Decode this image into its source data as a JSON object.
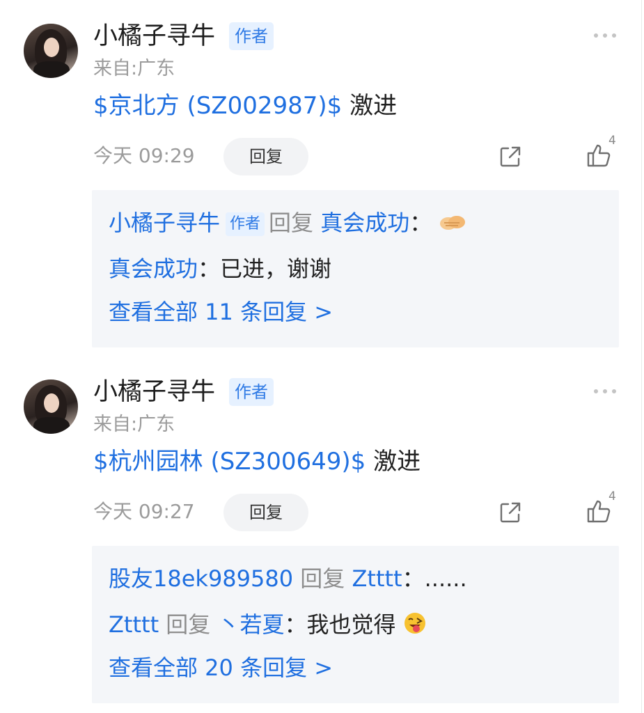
{
  "posts": [
    {
      "author": "小橘子寻牛",
      "author_badge": "作者",
      "location": "来自:广东",
      "stock_tag": "$京北方 (SZ002987)$",
      "text": " 激进",
      "time": "今天 09:29",
      "reply_label": "回复",
      "like_count": "4",
      "replies": [
        {
          "from": "小橘子寻牛",
          "badge": "作者",
          "verb": "回复",
          "to": "真会成功",
          "colon": "：",
          "text": "",
          "emoji": "handshake-emoji"
        },
        {
          "from": "真会成功",
          "colon": "：",
          "text": "已进，谢谢"
        }
      ],
      "view_all": "查看全部 11 条回复 >"
    },
    {
      "author": "小橘子寻牛",
      "author_badge": "作者",
      "location": "来自:广东",
      "stock_tag": "$杭州园林 (SZ300649)$",
      "text": " 激进",
      "time": "今天 09:27",
      "reply_label": "回复",
      "like_count": "4",
      "replies": [
        {
          "from": "股友18ek989580",
          "verb": "回复",
          "to": "Ztttt",
          "colon": "：",
          "text": "......"
        },
        {
          "from": "Ztttt",
          "verb": "回复",
          "to": "丶若夏",
          "colon": "：",
          "text": "我也觉得",
          "emoji": "winking-tongue-emoji"
        }
      ],
      "view_all": "查看全部 20 条回复 >"
    }
  ],
  "colors": {
    "link_blue": "#1f6fe0",
    "badge_bg": "#e6f1ff",
    "reply_panel_bg": "#f4f6f9",
    "muted_text": "#9b9b9b"
  }
}
